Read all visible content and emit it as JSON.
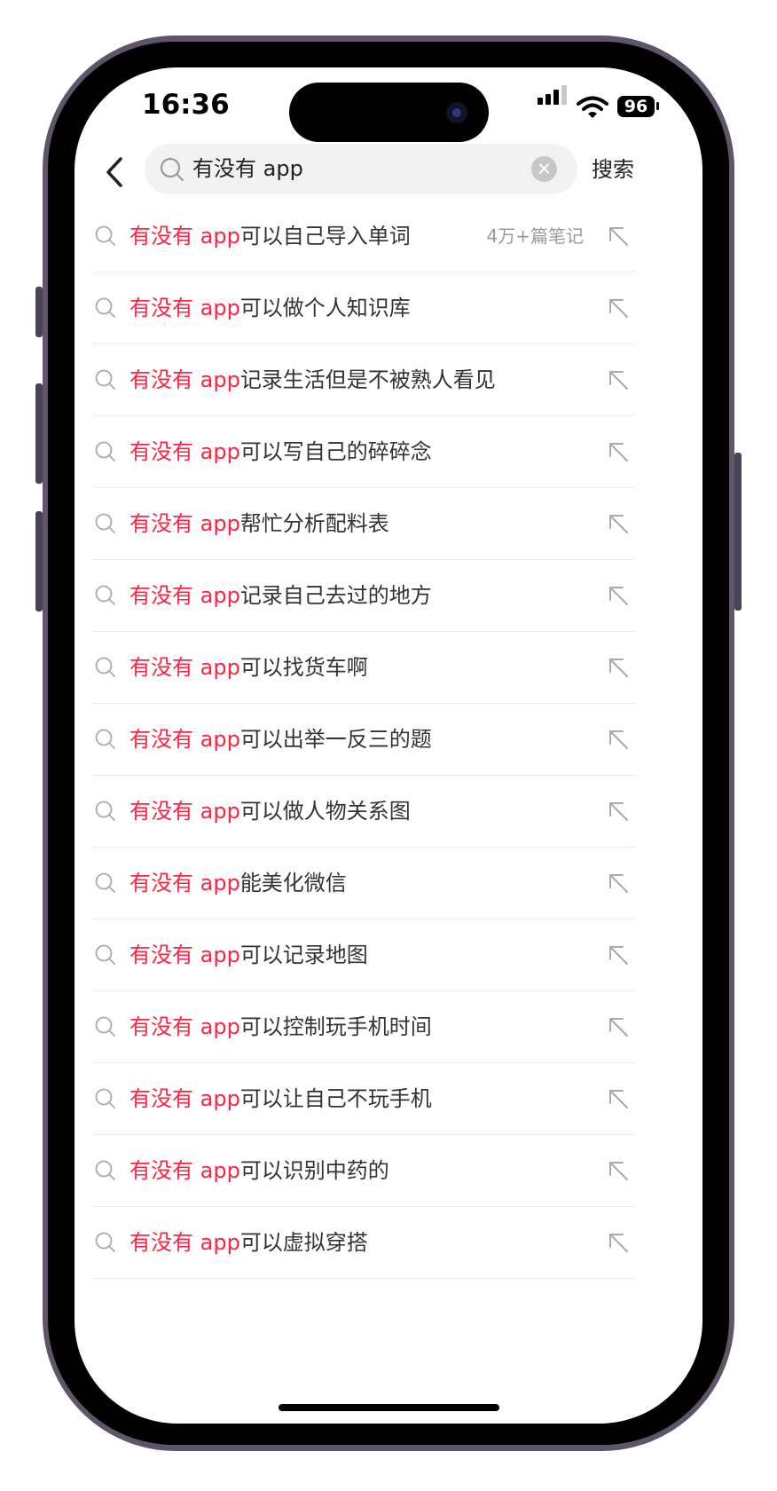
{
  "status_bar": {
    "time": "16:36",
    "battery": "96"
  },
  "search": {
    "query": "有没有 app",
    "submit_label": "搜索"
  },
  "suggestions": [
    {
      "highlight": "有没有 app",
      "rest": "可以自己导入单词",
      "count": "4万+篇笔记"
    },
    {
      "highlight": "有没有 app",
      "rest": "可以做个人知识库"
    },
    {
      "highlight": "有没有 app",
      "rest": "记录生活但是不被熟人看见"
    },
    {
      "highlight": "有没有 app",
      "rest": "可以写自己的碎碎念"
    },
    {
      "highlight": "有没有 app",
      "rest": "帮忙分析配料表"
    },
    {
      "highlight": "有没有 app",
      "rest": "记录自己去过的地方"
    },
    {
      "highlight": "有没有 app",
      "rest": "可以找货车啊"
    },
    {
      "highlight": "有没有 app",
      "rest": "可以出举一反三的题"
    },
    {
      "highlight": "有没有 app",
      "rest": "可以做人物关系图"
    },
    {
      "highlight": "有没有 app",
      "rest": "能美化微信"
    },
    {
      "highlight": "有没有 app",
      "rest": "可以记录地图"
    },
    {
      "highlight": "有没有 app",
      "rest": "可以控制玩手机时间"
    },
    {
      "highlight": "有没有 app",
      "rest": "可以让自己不玩手机"
    },
    {
      "highlight": "有没有 app",
      "rest": "可以识别中药的"
    },
    {
      "highlight": "有没有 app",
      "rest": "可以虚拟穿搭"
    }
  ],
  "colors": {
    "highlight": "#ff2442",
    "text": "#333333",
    "muted": "#999999"
  }
}
